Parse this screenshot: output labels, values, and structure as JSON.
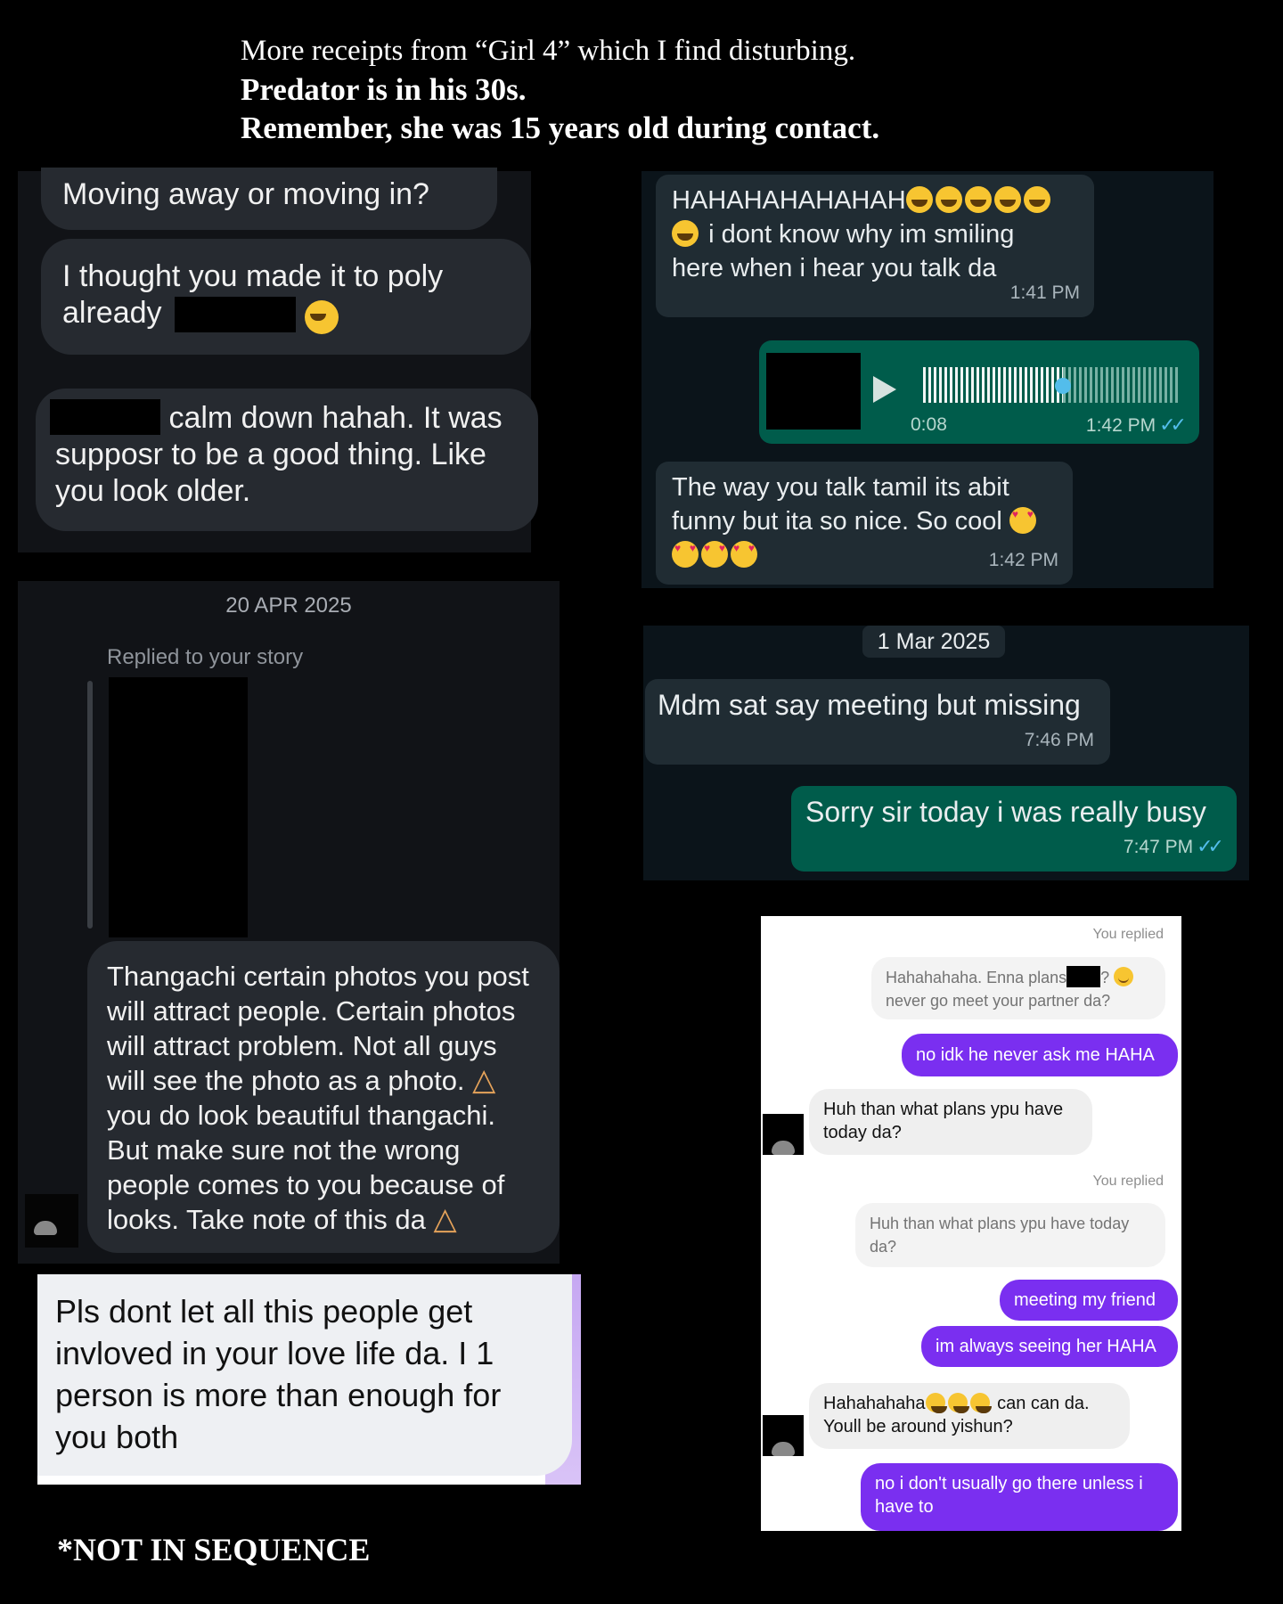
{
  "header": {
    "line1": "More receipts from “Girl 4” which I find disturbing.",
    "line2": "Predator is in his 30s.",
    "line3": "Remember, she was 15 years old during contact."
  },
  "panel_top_left": {
    "msg1": "Moving away or moving in?",
    "msg2_line1": "I thought you made it to poly",
    "msg2_line2": "already",
    "msg3_line1": "calm down hahah. It was",
    "msg3_line2": "supposr to be a good thing. Like",
    "msg3_line3": "you look older."
  },
  "panel_story": {
    "date": "20 APR 2025",
    "replied_label": "Replied to your story",
    "msg_lines": [
      "Thangachi certain photos you post",
      "will attract people. Certain photos",
      "will attract problem. Not all guys",
      "will see the photo as a photo.",
      "you do look beautiful thangachi.",
      "But make sure not the wrong",
      "people comes to you because of",
      "looks. Take note of this da"
    ]
  },
  "panel_love": {
    "lines": [
      "Pls dont let all this people get",
      "invloved in your love life da. I 1",
      "person is more than enough for",
      "you both"
    ]
  },
  "panel_wa_top": {
    "msg1_line1": "HAHAHAHAHAHAH",
    "msg1_line2": "i dont know why im smiling",
    "msg1_line3": "here when i hear you talk da",
    "msg1_time": "1:41 PM",
    "voice_duration": "0:08",
    "voice_time": "1:42 PM",
    "voice_progress": 0.55,
    "msg3_line1": "The way you talk tamil its abit",
    "msg3_line2": "funny but ita so nice. So cool",
    "msg3_time": "1:42 PM"
  },
  "panel_wa_mid": {
    "date": "1 Mar 2025",
    "msg1": "Mdm sat say meeting but missing",
    "msg1_time": "7:46 PM",
    "msg2": "Sorry sir today i was really busy",
    "msg2_time": "7:47 PM"
  },
  "panel_ig_light": {
    "you_replied_1": "You replied",
    "quote1_line1": "Hahahahaha. Enna plans",
    "quote1_line1_end": "?",
    "quote1_line2": "never go meet your partner da?",
    "out1": "no idk he never ask me HAHA",
    "in1_line1": "Huh than what plans ypu have",
    "in1_line2": "today da?",
    "you_replied_2": "You replied",
    "quote2_line1": "Huh than what plans ypu have today",
    "quote2_line2": "da?",
    "out2": "meeting my friend",
    "out3": "im always seeing her HAHA",
    "in2_line1_a": "Hahahahaha",
    "in2_line1_b": "can can da.",
    "in2_line2": "Youll be around yishun?",
    "out4_line1": "no i don't usually go there unless i",
    "out4_line2": "have to"
  },
  "footer": {
    "note": "*NOT IN SEQUENCE"
  },
  "colors": {
    "wa_outgoing": "#005c4b",
    "wa_incoming": "#202c33",
    "ig_outgoing": "#7a2ff0",
    "read_tick": "#53bdeb"
  }
}
